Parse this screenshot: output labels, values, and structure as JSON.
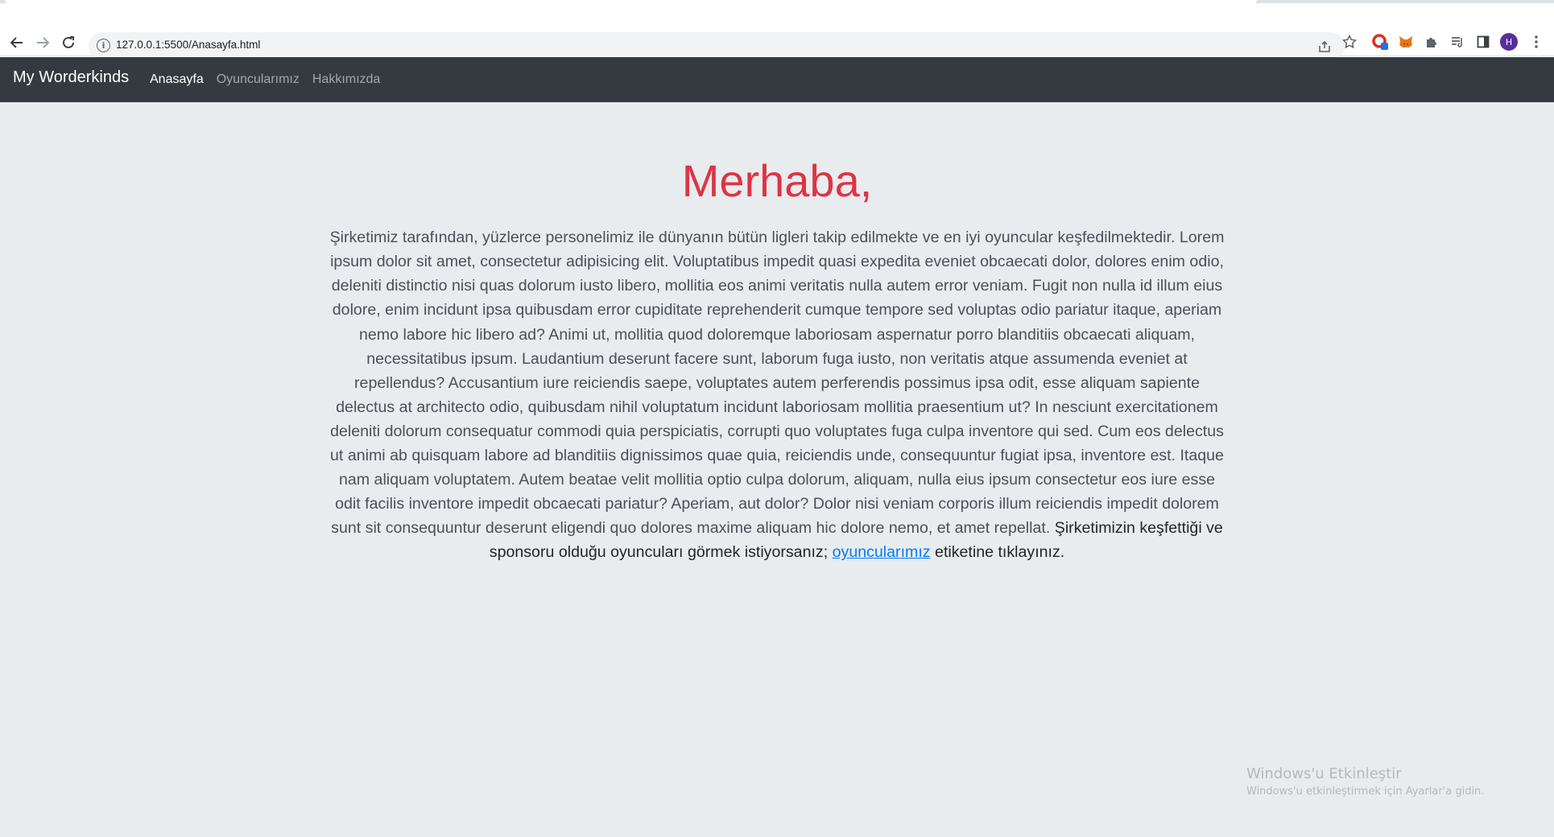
{
  "browser": {
    "url": "127.0.0.1:5500/Anasayfa.html"
  },
  "icons": {
    "back": "back-arrow-icon",
    "forward": "forward-arrow-icon",
    "reload": "reload-icon",
    "info": "info-icon",
    "share": "share-icon",
    "bookmark": "star-icon",
    "extension_red": "red-extension-icon",
    "extension_fox": "metamask-fox-icon",
    "extensions": "puzzle-icon",
    "reading_list": "reading-list-icon",
    "side_panel": "side-panel-icon",
    "menu": "kebab-menu-icon"
  },
  "profile": {
    "initial": "H"
  },
  "navbar": {
    "brand": "My Worderkinds",
    "links": [
      {
        "label": "Anasayfa",
        "active": true
      },
      {
        "label": "Oyuncularımız",
        "active": false
      },
      {
        "label": "Hakkımızda",
        "active": false
      }
    ]
  },
  "jumbotron": {
    "heading": "Merhaba,",
    "lead_text": "Şirketimiz tarafından, yüzlerce personelimiz ile dünyanın bütün ligleri takip edilmekte ve en iyi oyuncular keşfedilmektedir. Lorem ipsum dolor sit amet, consectetur adipisicing elit. Voluptatibus impedit quasi expedita eveniet obcaecati dolor, dolores enim odio, deleniti distinctio nisi quas dolorum iusto libero, mollitia eos animi veritatis nulla autem error veniam. Fugit non nulla id illum eius dolore, enim incidunt ipsa quibusdam error cupiditate reprehenderit cumque tempore sed voluptas odio pariatur itaque, aperiam nemo labore hic libero ad? Animi ut, mollitia quod doloremque laboriosam aspernatur porro blanditiis obcaecati aliquam, necessitatibus ipsum. Laudantium deserunt facere sunt, laborum fuga iusto, non veritatis atque assumenda eveniet at repellendus? Accusantium iure reiciendis saepe, voluptates autem perferendis possimus ipsa odit, esse aliquam sapiente delectus at architecto odio, quibusdam nihil voluptatum incidunt laboriosam mollitia praesentium ut? In nesciunt exercitationem deleniti dolorum consequatur commodi quia perspiciatis, corrupti quo voluptates fuga culpa inventore qui sed. Cum eos delectus ut animi ab quisquam labore ad blanditiis dignissimos quae quia, reiciendis unde, consequuntur fugiat ipsa, inventore est. Itaque nam aliquam voluptatem. Autem beatae velit mollitia optio culpa dolorum, aliquam, nulla eius ipsum consectetur eos iure esse odit facilis inventore impedit obcaecati pariatur? Aperiam, aut dolor? Dolor nisi veniam corporis illum reiciendis impedit dolorem sunt sit consequuntur deserunt eligendi quo dolores maxime aliquam hic dolore nemo, et amet repellat.",
    "cta_before": "Şirketimizin keşfettiği ve sponsoru olduğu oyuncuları görmek istiyorsanız;",
    "cta_link": "oyuncularımız",
    "cta_after": "etiketine tıklayınız."
  },
  "watermark": {
    "title": "Windows'u Etkinleştir",
    "subtitle": "Windows'u etkinleştirmek için Ayarlar'a gidin."
  },
  "colors": {
    "navbar_bg": "#343a40",
    "page_bg": "#e9ecef",
    "heading": "#dc3545",
    "link": "#007bff"
  }
}
